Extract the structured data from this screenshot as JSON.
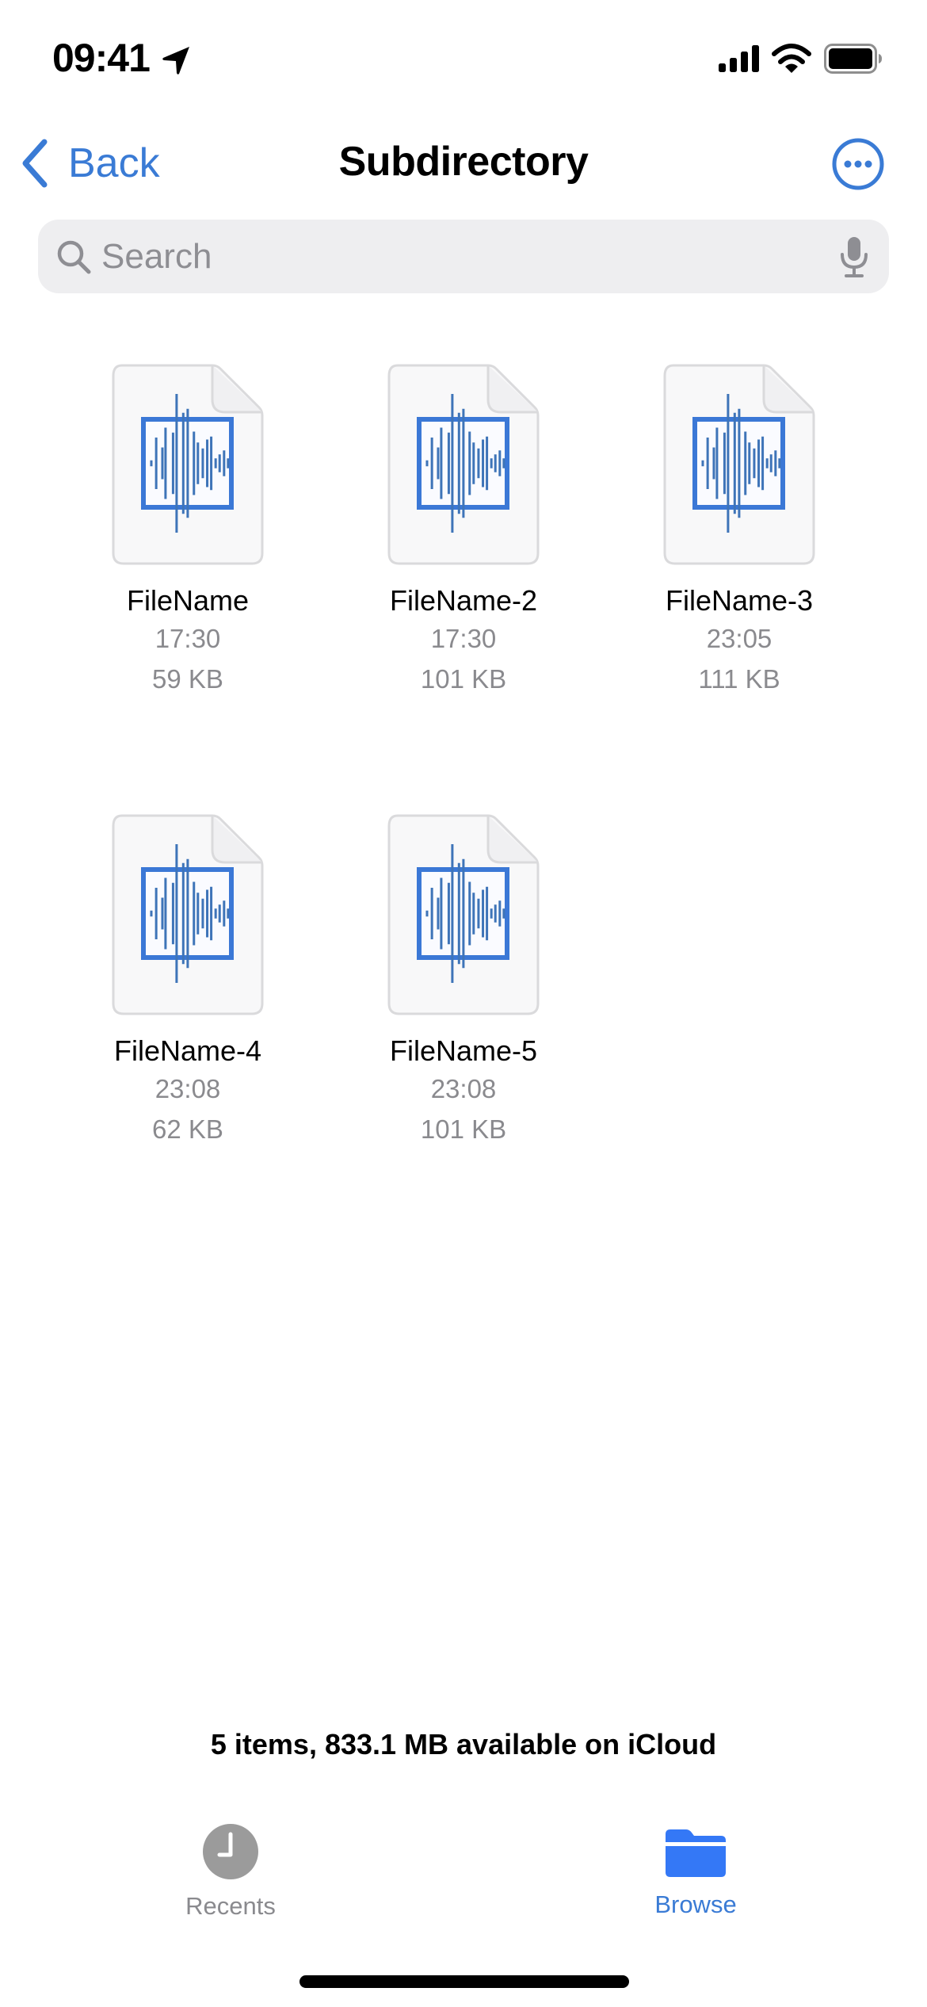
{
  "status_bar": {
    "time": "09:41",
    "icons": [
      "location-arrow-icon",
      "cellular-signal-icon",
      "wifi-icon",
      "battery-icon"
    ]
  },
  "nav": {
    "back_label": "Back",
    "title": "Subdirectory",
    "more_icon": "ellipsis-circle-icon"
  },
  "search": {
    "placeholder": "Search",
    "value": "",
    "icons": [
      "magnifying-glass-icon",
      "microphone-icon"
    ]
  },
  "files": [
    {
      "name": "FileName",
      "time": "17:30",
      "size": "59 KB",
      "icon": "audio-file-icon"
    },
    {
      "name": "FileName-2",
      "time": "17:30",
      "size": "101 KB",
      "icon": "audio-file-icon"
    },
    {
      "name": "FileName-3",
      "time": "23:05",
      "size": "111 KB",
      "icon": "audio-file-icon"
    },
    {
      "name": "FileName-4",
      "time": "23:08",
      "size": "62 KB",
      "icon": "audio-file-icon"
    },
    {
      "name": "FileName-5",
      "time": "23:08",
      "size": "101 KB",
      "icon": "audio-file-icon"
    }
  ],
  "summary": "5 items, 833.1 MB available on iCloud",
  "tab_bar": {
    "tabs": [
      {
        "label": "Recents",
        "icon": "clock-icon",
        "selected": false
      },
      {
        "label": "Browse",
        "icon": "folder-icon",
        "selected": true
      }
    ]
  },
  "colors": {
    "accent": "#3A7BD5",
    "tab_selected": "#3478F6",
    "tab_inactive": "#9B9B9B",
    "secondary_text": "#8A8A8E",
    "search_bg": "#EEEEF0"
  }
}
